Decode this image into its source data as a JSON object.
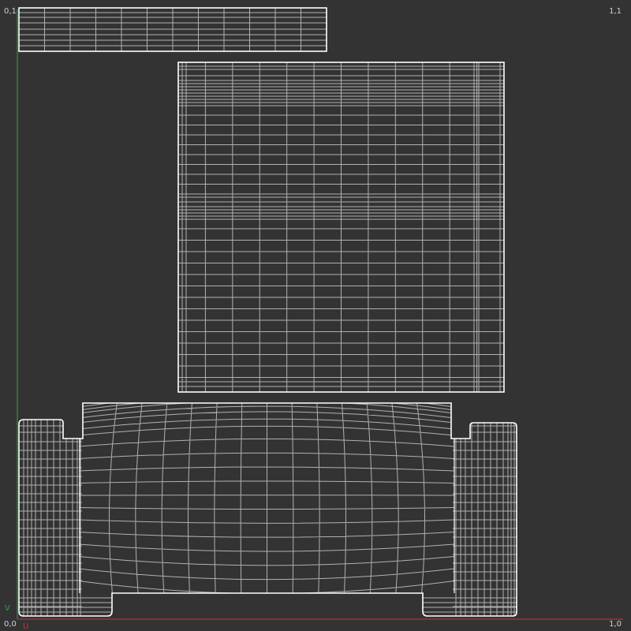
{
  "corners": {
    "top_left": "0,1",
    "top_right": "1,1",
    "bottom_left": "0,0",
    "bottom_right": "1,0"
  },
  "axes": {
    "v_label": "V",
    "u_label": "U",
    "v_color": "#2ca64a",
    "u_color": "#d03232"
  },
  "colors": {
    "background": "#333333",
    "wire": "#c8c8c8",
    "border": "#ffffff"
  }
}
